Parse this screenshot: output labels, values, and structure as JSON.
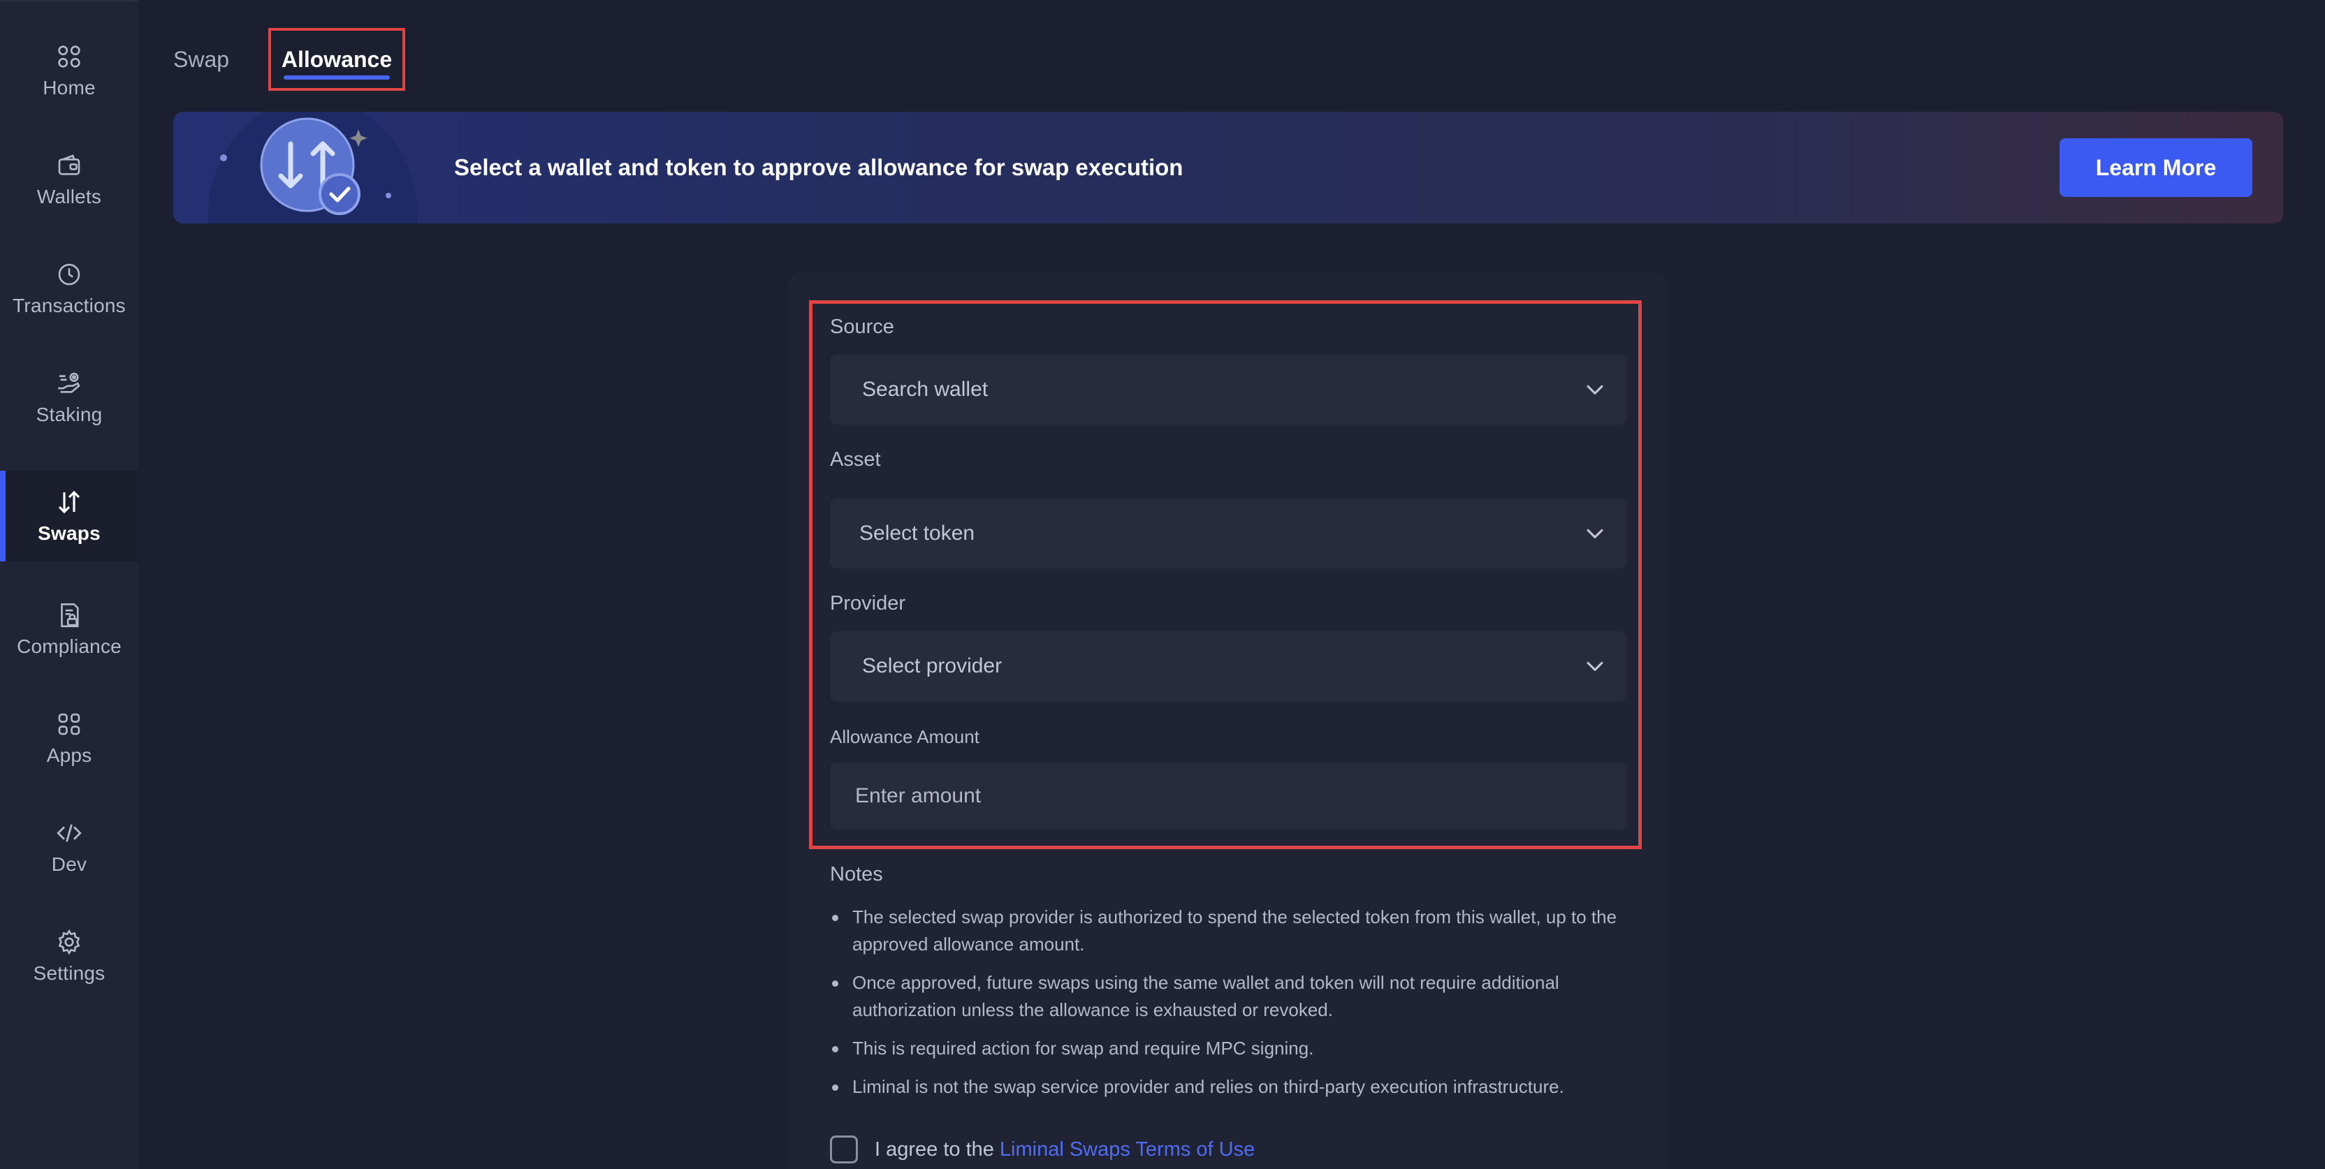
{
  "sidebar": {
    "items": [
      {
        "label": "Home",
        "icon": "home-grid-icon"
      },
      {
        "label": "Wallets",
        "icon": "wallet-icon"
      },
      {
        "label": "Transactions",
        "icon": "clock-icon"
      },
      {
        "label": "Staking",
        "icon": "staking-hand-icon"
      },
      {
        "label": "Swaps",
        "icon": "swap-arrows-icon",
        "active": true
      },
      {
        "label": "Compliance",
        "icon": "compliance-lock-icon"
      },
      {
        "label": "Apps",
        "icon": "apps-grid-icon"
      },
      {
        "label": "Dev",
        "icon": "code-icon"
      },
      {
        "label": "Settings",
        "icon": "gear-icon"
      }
    ]
  },
  "tabs": [
    {
      "label": "Swap",
      "active": false
    },
    {
      "label": "Allowance",
      "active": true
    }
  ],
  "banner": {
    "text": "Select a wallet and token to approve allowance for swap execution",
    "button_label": "Learn More"
  },
  "form": {
    "source": {
      "label": "Source",
      "placeholder": "Search wallet"
    },
    "asset": {
      "label": "Asset",
      "placeholder": "Select token"
    },
    "provider": {
      "label": "Provider",
      "placeholder": "Select provider"
    },
    "amount": {
      "label": "Allowance Amount",
      "placeholder": "Enter amount"
    }
  },
  "notes": {
    "title": "Notes",
    "items": [
      "The selected swap provider is authorized to spend the selected token from this wallet, up to the approved allowance amount.",
      "Once approved, future swaps using the same wallet and token will not require additional authorization unless the allowance is exhausted or revoked.",
      "This is required action for swap and require MPC signing.",
      "Liminal is not the swap service provider and relies on third-party execution infrastructure."
    ]
  },
  "agreement": {
    "text": "I agree to the",
    "link": "Liminal Swaps Terms of Use"
  },
  "colors": {
    "accent": "#3b5af2",
    "highlight": "#e04444",
    "background": "#1b1f30",
    "sidebar": "#202436"
  }
}
